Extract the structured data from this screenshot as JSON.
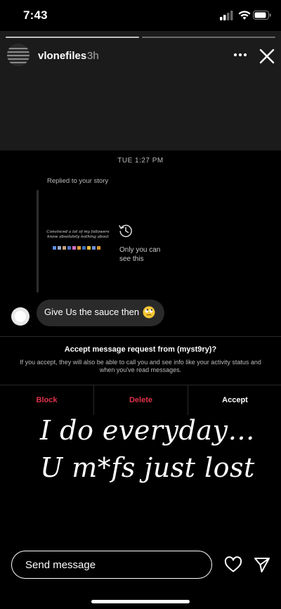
{
  "status_bar": {
    "time": "7:43"
  },
  "story": {
    "username": "vlonefiles",
    "time_ago": "3h",
    "caption_line1": "I do everyday…",
    "caption_line2": "U m*fs just lost",
    "progress_segments": [
      1,
      0
    ]
  },
  "dm": {
    "timestamp": "TUE 1:27 PM",
    "replied_label": "Replied to your story",
    "story_preview_text": "Convinced a lot of my followers know absolutely nothing about",
    "only_you_label": "Only you can see this",
    "message_text": "Give Us the sauce then",
    "message_emoji": "rolling-eyes-emoji"
  },
  "request": {
    "title": "Accept message request from  (myst9ry)?",
    "description": "If you accept, they will also be able to call you and see info like your activity status and when you've read messages.",
    "block_label": "Block",
    "delete_label": "Delete",
    "accept_label": "Accept"
  },
  "composer": {
    "placeholder": "Send message"
  },
  "colors": {
    "danger": "#e0334a",
    "background": "#000000",
    "story_top": "#1b1b1b",
    "bubble": "#2a2a2a"
  },
  "icons": [
    "cellular-signal-icon",
    "wifi-icon",
    "battery-icon",
    "more-icon",
    "close-icon",
    "history-icon",
    "heart-icon",
    "send-icon"
  ]
}
